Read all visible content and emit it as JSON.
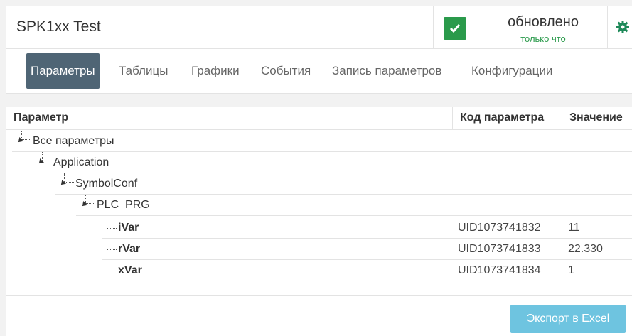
{
  "header": {
    "device_title": "SPK1xx Test",
    "status": {
      "updated_label": "обновлено",
      "updated_time": "только что",
      "ok_color": "#2a9a4b"
    },
    "tabs": [
      {
        "label": "Параметры",
        "active": true
      },
      {
        "label": "Таблицы"
      },
      {
        "label": "Графики"
      },
      {
        "label": "События"
      },
      {
        "label": "Запись параметров"
      },
      {
        "label": "Конфигурации"
      }
    ]
  },
  "table": {
    "columns": [
      "Параметр",
      "Код параметра",
      "Значение"
    ],
    "rows": [
      {
        "label": "Все параметры",
        "level": 0,
        "expanded": true
      },
      {
        "label": "Application",
        "level": 1,
        "expanded": true
      },
      {
        "label": "SymbolConf",
        "level": 2,
        "expanded": true
      },
      {
        "label": "PLC_PRG",
        "level": 3,
        "expanded": true
      },
      {
        "label": "iVar",
        "level": 4,
        "code": "UID1073741832",
        "value": "11"
      },
      {
        "label": "rVar",
        "level": 4,
        "code": "UID1073741833",
        "value": "22.330"
      },
      {
        "label": "xVar",
        "level": 4,
        "code": "UID1073741834",
        "value": "1"
      }
    ]
  },
  "footer": {
    "export_label": "Экспорт в Excel"
  },
  "colors": {
    "accent": "#4f6575",
    "export_button": "#6ec4e0"
  }
}
